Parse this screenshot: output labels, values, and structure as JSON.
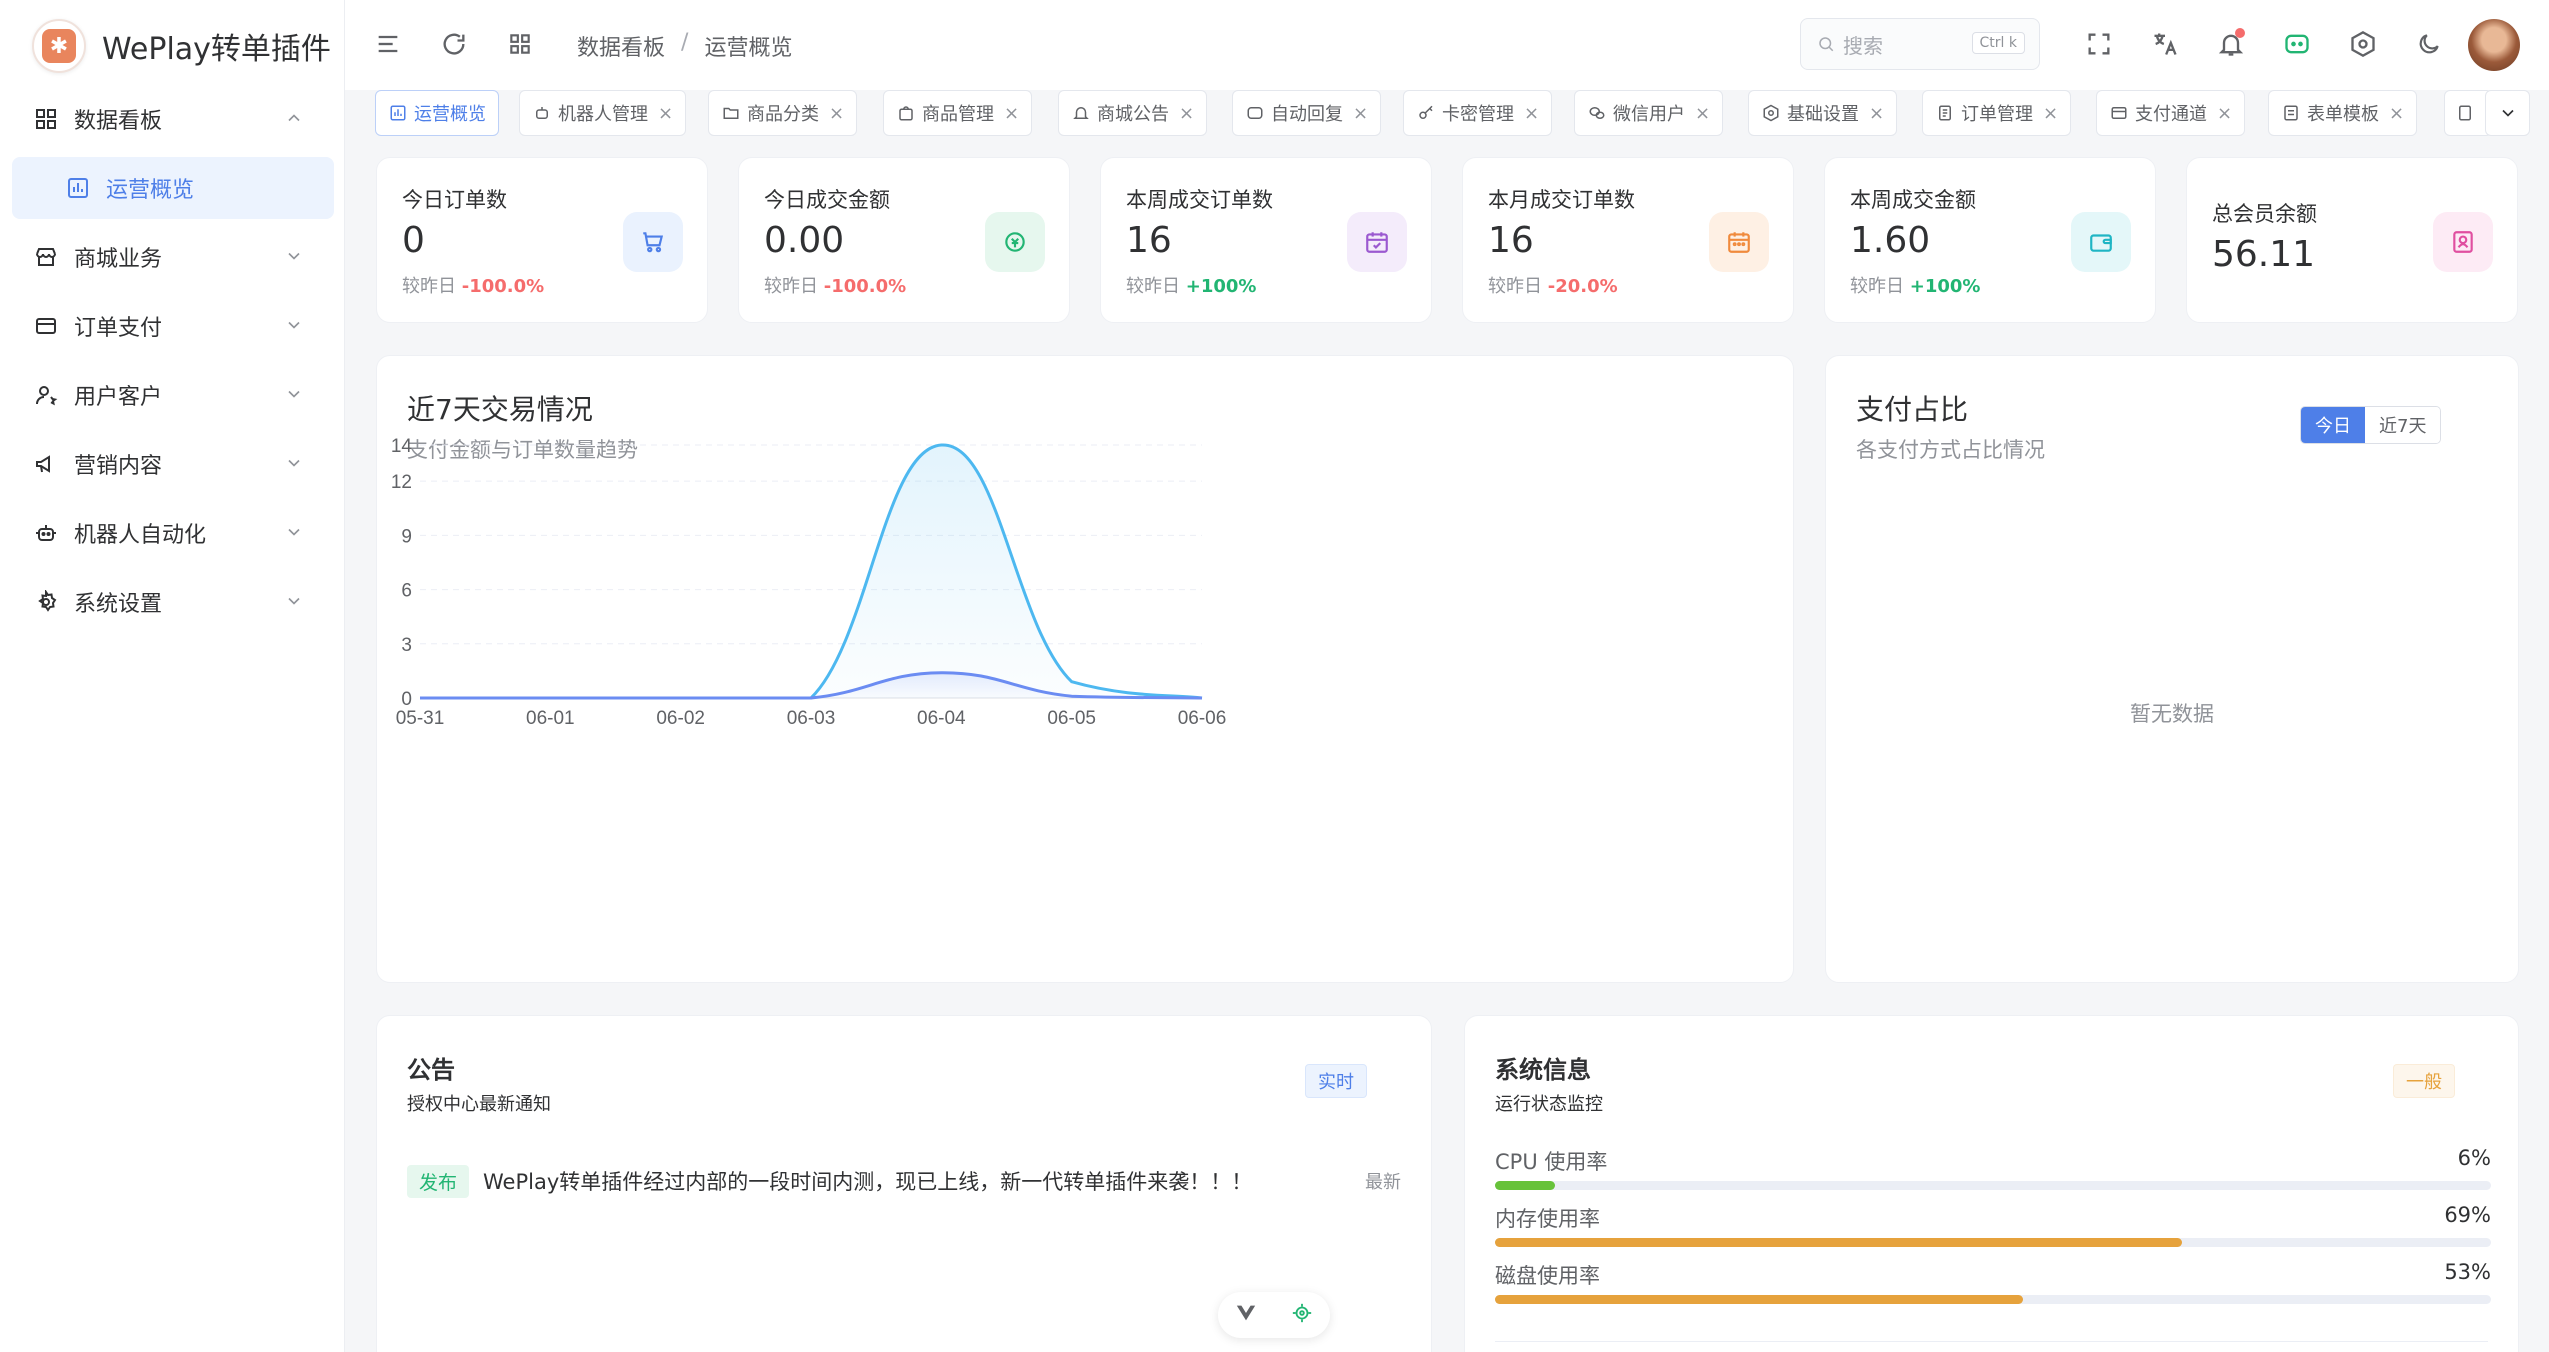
{
  "brand": {
    "name": "WePlay转单插件"
  },
  "sidebar": {
    "items": [
      {
        "label": "数据看板",
        "icon": "dashboard-icon",
        "expanded": true
      },
      {
        "label": "运营概览",
        "icon": "chart-icon",
        "active": true
      },
      {
        "label": "商城业务",
        "icon": "shop-icon"
      },
      {
        "label": "订单支付",
        "icon": "card-icon"
      },
      {
        "label": "用户客户",
        "icon": "user-icon"
      },
      {
        "label": "营销内容",
        "icon": "megaphone-icon"
      },
      {
        "label": "机器人自动化",
        "icon": "robot-icon"
      },
      {
        "label": "系统设置",
        "icon": "gear-icon"
      }
    ]
  },
  "header": {
    "breadcrumb": [
      "数据看板",
      "运营概览"
    ],
    "search_placeholder": "搜索",
    "search_shortcut": "Ctrl k"
  },
  "tabs": [
    {
      "label": "运营概览",
      "active": true,
      "closable": false
    },
    {
      "label": "机器人管理"
    },
    {
      "label": "商品分类"
    },
    {
      "label": "商品管理"
    },
    {
      "label": "商城公告"
    },
    {
      "label": "自动回复"
    },
    {
      "label": "卡密管理"
    },
    {
      "label": "微信用户"
    },
    {
      "label": "基础设置"
    },
    {
      "label": "订单管理"
    },
    {
      "label": "支付通道"
    },
    {
      "label": "表单模板"
    }
  ],
  "stats": [
    {
      "label": "今日订单数",
      "value": "0",
      "cmp_label": "较昨日",
      "cmp": "-100.0%",
      "trend": "down",
      "icon": "cart-icon",
      "icon_color": "#4e7fe8",
      "icon_bg": "#eaf2fe"
    },
    {
      "label": "今日成交金额",
      "value": "0.00",
      "cmp_label": "较昨日",
      "cmp": "-100.0%",
      "trend": "down",
      "icon": "coin-icon",
      "icon_color": "#22b573",
      "icon_bg": "#e6f7ee"
    },
    {
      "label": "本周成交订单数",
      "value": "16",
      "cmp_label": "较昨日",
      "cmp": "+100%",
      "trend": "up",
      "icon": "calendar-check-icon",
      "icon_color": "#9b59d0",
      "icon_bg": "#f4ecfb"
    },
    {
      "label": "本月成交订单数",
      "value": "16",
      "cmp_label": "较昨日",
      "cmp": "-20.0%",
      "trend": "down",
      "icon": "calendar-icon",
      "icon_color": "#f08a3c",
      "icon_bg": "#fef0e4"
    },
    {
      "label": "本周成交金额",
      "value": "1.60",
      "cmp_label": "较昨日",
      "cmp": "+100%",
      "trend": "up",
      "icon": "wallet-icon",
      "icon_color": "#1fb5c4",
      "icon_bg": "#e4f7f9"
    },
    {
      "label": "总会员余额",
      "value": "56.11",
      "icon": "member-icon",
      "icon_color": "#e04fa0",
      "icon_bg": "#fdebf5"
    }
  ],
  "trend_panel": {
    "title": "近7天交易情况",
    "subtitle": "支付金额与订单数量趋势"
  },
  "chart_data": {
    "type": "area",
    "categories": [
      "05-31",
      "06-01",
      "06-02",
      "06-03",
      "06-04",
      "06-05",
      "06-06"
    ],
    "series": [
      {
        "values": [
          0,
          0,
          0,
          0,
          14,
          0.9,
          0
        ],
        "color": "#4db8f0"
      },
      {
        "values": [
          0,
          0,
          0,
          0,
          1.4,
          0.1,
          0
        ],
        "color": "#6b8cf2"
      }
    ],
    "yticks": [
      0,
      3,
      6,
      9,
      12,
      14
    ],
    "ylim": [
      0,
      14
    ],
    "grid": true
  },
  "pay_panel": {
    "title": "支付占比",
    "subtitle": "各支付方式占比情况",
    "options": [
      "今日",
      "近7天"
    ],
    "selected": "今日",
    "empty": "暂无数据"
  },
  "notice_panel": {
    "title": "公告",
    "subtitle": "授权中心最新通知",
    "badge": "实时",
    "items": [
      {
        "tag": "发布",
        "text": "WePlay转单插件经过内部的一段时间内测，现已上线，新一代转单插件来袭！！！",
        "time": "最新"
      }
    ]
  },
  "system_panel": {
    "title": "系统信息",
    "subtitle": "运行状态监控",
    "badge": "一般",
    "metrics": [
      {
        "label": "CPU 使用率",
        "percent": 6,
        "display": "6%",
        "color": "#67c23a"
      },
      {
        "label": "内存使用率",
        "percent": 69,
        "display": "69%",
        "color": "#e6a23c"
      },
      {
        "label": "磁盘使用率",
        "percent": 53,
        "display": "53%",
        "color": "#e6a23c"
      }
    ]
  }
}
